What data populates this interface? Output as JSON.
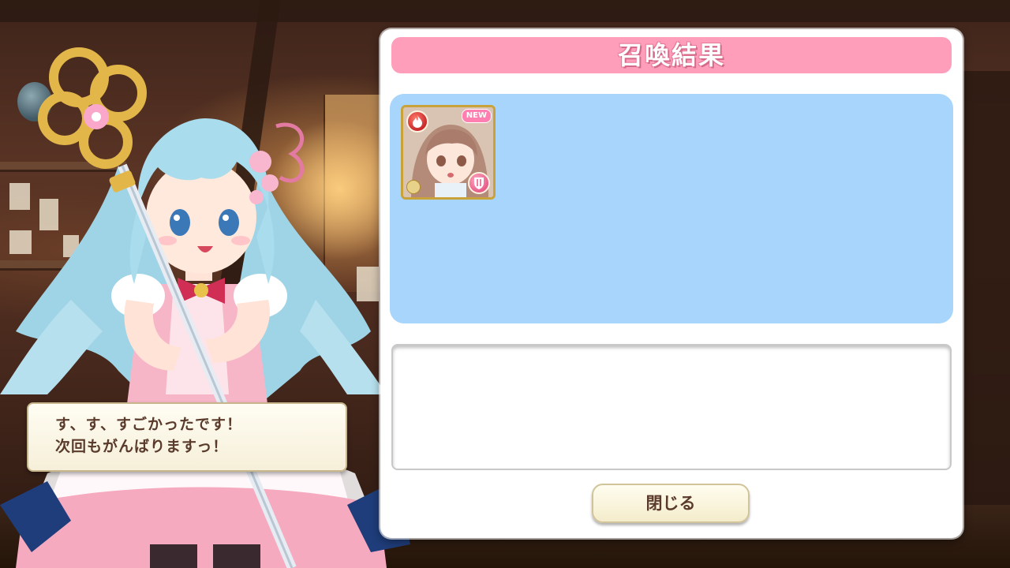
{
  "dialog": {
    "title": "召喚結果",
    "close_label": "閉じる"
  },
  "result": {
    "cards": [
      {
        "badge": "NEW",
        "element_icon": "fire-icon",
        "class_icon": "shield-icon",
        "rarity_icon": "rarity-icon"
      }
    ]
  },
  "speech": {
    "lines": [
      "す、す、すごかったです！",
      "次回もがんばりますっ！"
    ]
  },
  "colors": {
    "title_bar": "#ff9ebb",
    "result_area": "#a8d5fc",
    "button_text": "#5a3a2a"
  }
}
